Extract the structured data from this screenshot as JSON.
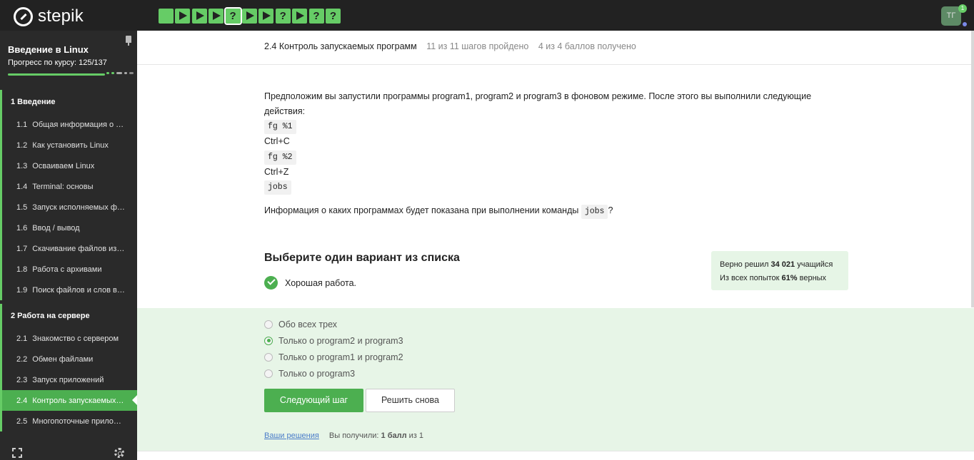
{
  "topbar": {
    "logo_text": "stepik",
    "steps": [
      {
        "type": "done",
        "glyph": ""
      },
      {
        "type": "play",
        "glyph": ""
      },
      {
        "type": "play",
        "glyph": ""
      },
      {
        "type": "play",
        "glyph": ""
      },
      {
        "type": "question",
        "glyph": "?"
      },
      {
        "type": "play",
        "glyph": ""
      },
      {
        "type": "play",
        "glyph": ""
      },
      {
        "type": "question",
        "glyph": "?"
      },
      {
        "type": "play",
        "glyph": ""
      },
      {
        "type": "question",
        "glyph": "?"
      },
      {
        "type": "question",
        "glyph": "?"
      }
    ],
    "avatar_initials": "ТГ",
    "notification_count": "1",
    "accent": "#66cc66"
  },
  "sidebar": {
    "course_title": "Введение в Linux",
    "progress_label": "Прогресс по курсу:  125/137",
    "progress_fraction": 0.912,
    "modules": [
      {
        "label": "1  Введение",
        "lessons": [
          {
            "num": "1.1",
            "label": "Общая информация о курсе"
          },
          {
            "num": "1.2",
            "label": "Как установить Linux"
          },
          {
            "num": "1.3",
            "label": "Осваиваем Linux"
          },
          {
            "num": "1.4",
            "label": "Terminal: основы"
          },
          {
            "num": "1.5",
            "label": "Запуск исполняемых файлов"
          },
          {
            "num": "1.6",
            "label": "Ввод / вывод"
          },
          {
            "num": "1.7",
            "label": "Скачивание файлов из интернета"
          },
          {
            "num": "1.8",
            "label": "Работа с архивами"
          },
          {
            "num": "1.9",
            "label": "Поиск файлов и слов в файлах"
          }
        ]
      },
      {
        "label": "2  Работа на сервере",
        "lessons": [
          {
            "num": "2.1",
            "label": "Знакомство с сервером"
          },
          {
            "num": "2.2",
            "label": "Обмен файлами"
          },
          {
            "num": "2.3",
            "label": "Запуск приложений"
          },
          {
            "num": "2.4",
            "label": "Контроль запускаемых программ"
          },
          {
            "num": "2.5",
            "label": "Многопоточные приложения"
          }
        ]
      }
    ]
  },
  "header": {
    "lesson_title": "2.4 Контроль запускаемых программ",
    "steps_done": "11 из 11 шагов пройдено",
    "score": "4 из 4 баллов  получено"
  },
  "question": {
    "intro": "Предположим вы запустили программы program1, program2 и program3 в фоновом режиме. После этого вы выполнили следующие действия:",
    "cmd1": "fg %1",
    "action1": "Ctrl+C",
    "cmd2": "fg %2",
    "action2": "Ctrl+Z",
    "cmd3": "jobs",
    "ask_before": "Информация о каких программах будет показана при выполнении команды",
    "ask_code": "jobs",
    "ask_after": "?"
  },
  "quiz": {
    "title": "Выберите один вариант из списка",
    "feedback": "Хорошая работа.",
    "options": [
      {
        "label": "Обо всех трех",
        "checked": false
      },
      {
        "label": "Только о program2 и program3",
        "checked": true
      },
      {
        "label": "Только о program1 и program2",
        "checked": false
      },
      {
        "label": "Только о program3",
        "checked": false
      }
    ],
    "next_button": "Следующий шаг",
    "retry_button": "Решить снова"
  },
  "stats": {
    "line1_prefix": "Верно решил",
    "line1_count": "34 021",
    "line1_suffix": "учащийся",
    "line2_prefix": "Из всех попыток",
    "line2_pct": "61%",
    "line2_suffix": "верных"
  },
  "footer": {
    "solutions_link": "Ваши решения",
    "result_prefix": "Вы получили:",
    "result_value": "1 балл",
    "result_suffix": "из 1"
  }
}
